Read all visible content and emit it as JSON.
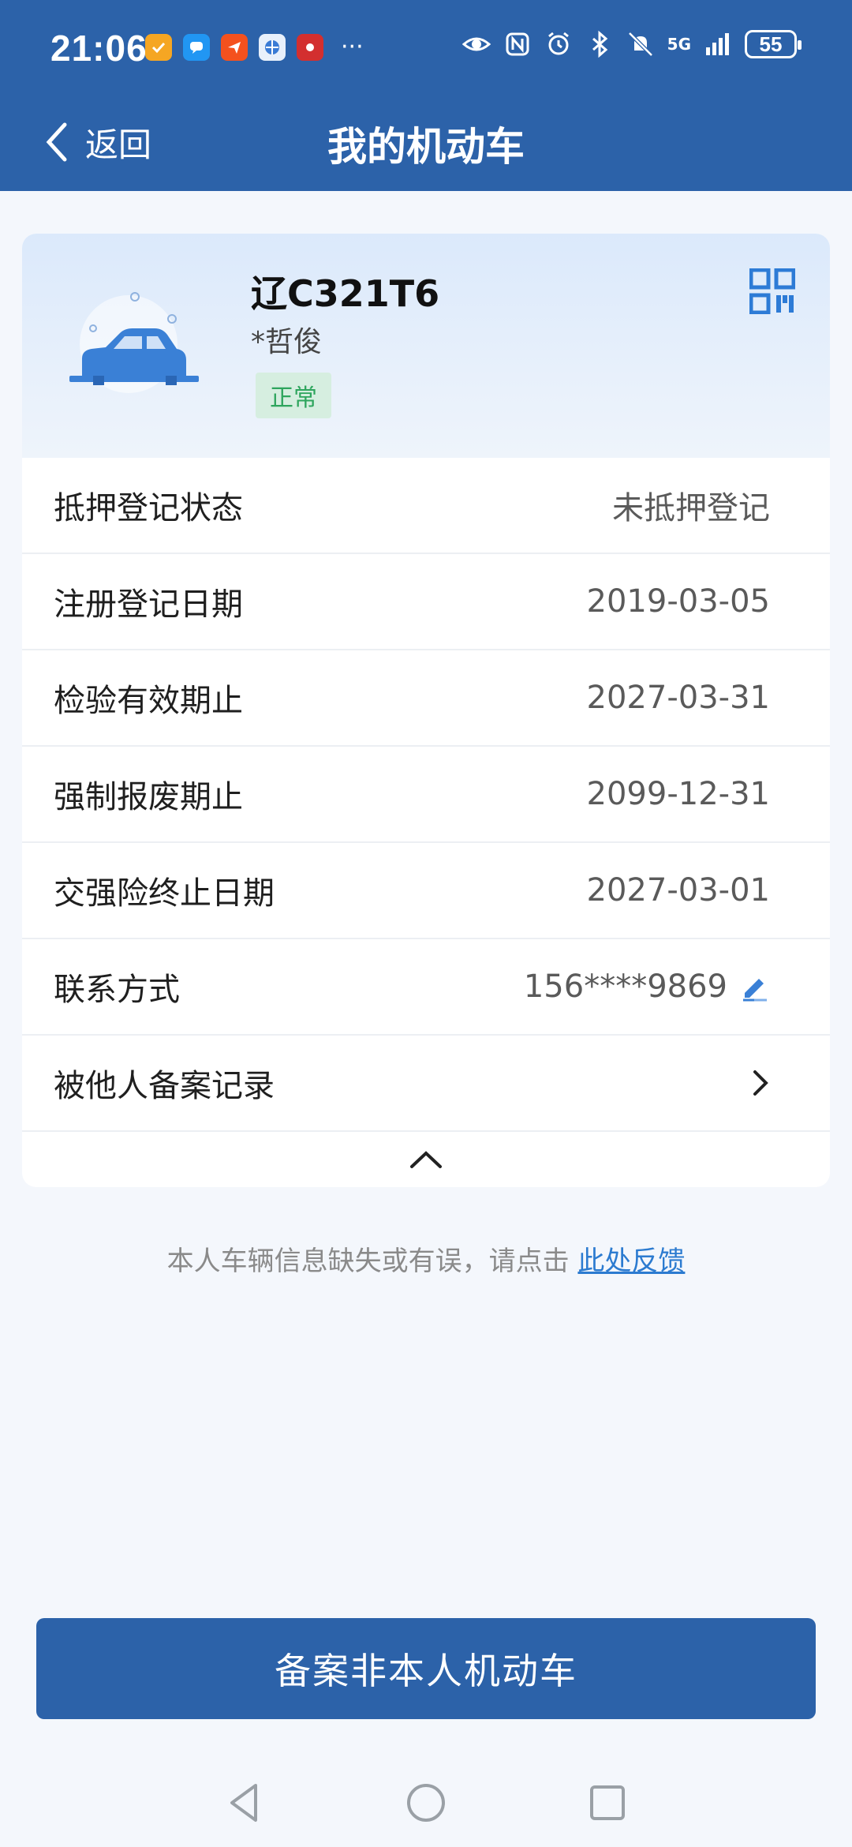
{
  "status_bar": {
    "time": "21:06",
    "more": "···",
    "network": "5G",
    "battery": "55"
  },
  "navbar": {
    "back_label": "返回",
    "title": "我的机动车"
  },
  "vehicle": {
    "plate": "辽C321T6",
    "owner": "*哲俊",
    "status": "正常",
    "status_color": "#2ea55d"
  },
  "details": [
    {
      "label": "抵押登记状态",
      "value": "未抵押登记"
    },
    {
      "label": "注册登记日期",
      "value": "2019-03-05"
    },
    {
      "label": "检验有效期止",
      "value": "2027-03-31"
    },
    {
      "label": "强制报废期止",
      "value": "2099-12-31"
    },
    {
      "label": "交强险终止日期",
      "value": "2027-03-01"
    },
    {
      "label": "联系方式",
      "value": "156****9869"
    },
    {
      "label": "被他人备案记录",
      "value": ""
    }
  ],
  "feedback": {
    "text": "本人车辆信息缺失或有误，请点击 ",
    "link": "此处反馈"
  },
  "primary_button": "备案非本人机动车",
  "colors": {
    "brand": "#2c62a9",
    "link": "#2c7bd0",
    "background": "#f4f7fc"
  }
}
